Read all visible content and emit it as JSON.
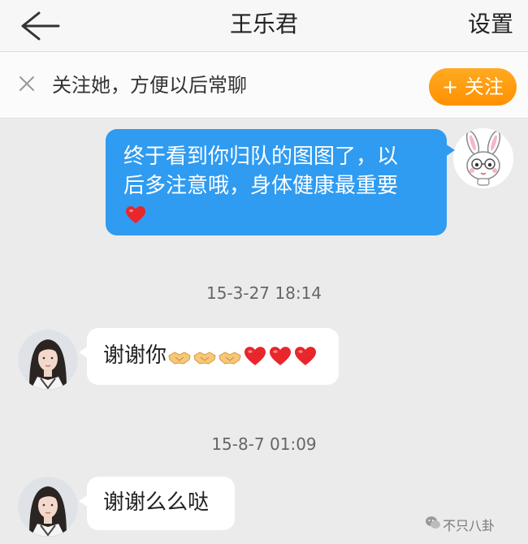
{
  "header": {
    "back_icon": "arrow-left-icon",
    "title": "王乐君",
    "settings_label": "设置"
  },
  "follow_bar": {
    "close_icon": "close-icon",
    "prompt": "关注她，方便以后常聊",
    "button_label": "+ 关注",
    "button_color": "#ff9900"
  },
  "messages": [
    {
      "sender": "me",
      "text_line1": "终于看到你归队的图图了，以",
      "text_line2": "后多注意哦，身体健康最重要",
      "emoji": "red-heart",
      "bubble_color": "#2f9bf1"
    },
    {
      "timestamp": "15-3-27 18:14"
    },
    {
      "sender": "her",
      "text": "谢谢你",
      "emojis": [
        "handshake",
        "handshake",
        "handshake",
        "red-heart",
        "red-heart",
        "red-heart"
      ]
    },
    {
      "timestamp": "15-8-7 01:09"
    },
    {
      "sender": "her",
      "text": "谢谢么么哒"
    }
  ],
  "watermark": {
    "icon": "wechat-icon",
    "text": "不只八卦"
  }
}
